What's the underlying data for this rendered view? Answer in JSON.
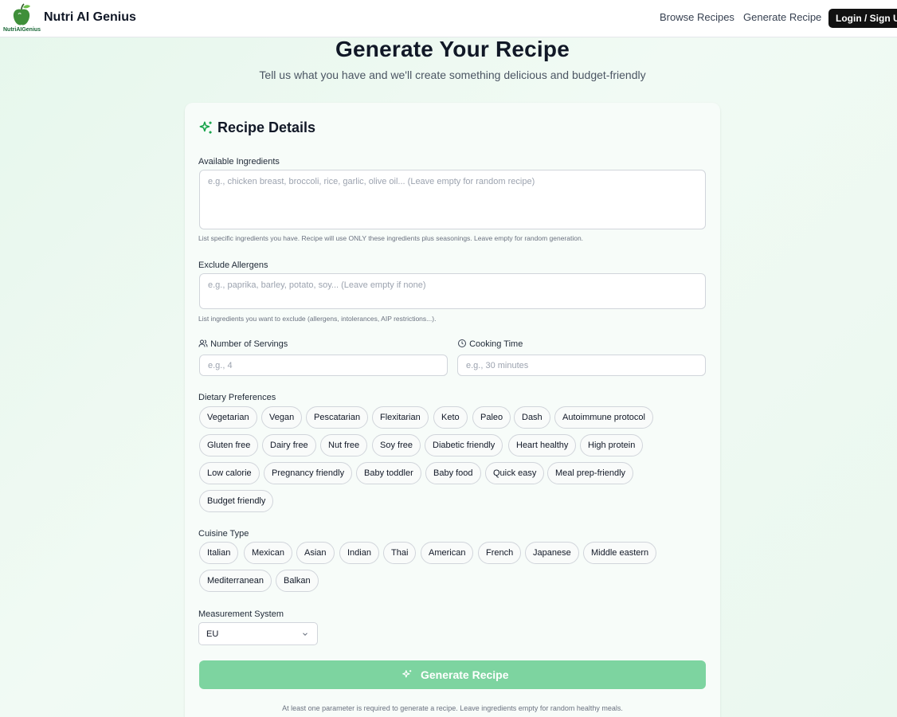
{
  "header": {
    "logo_caption": "NutriAIGenius",
    "brand": "Nutri AI Genius",
    "nav": {
      "browse": "Browse Recipes",
      "generate": "Generate Recipe"
    },
    "login": "Login / Sign Up"
  },
  "page": {
    "title": "Generate Your Recipe",
    "subtitle": "Tell us what you have and we'll create something delicious and budget-friendly"
  },
  "card": {
    "title": "Recipe Details",
    "ingredients": {
      "label": "Available Ingredients",
      "placeholder": "e.g., chicken breast, broccoli, rice, garlic, olive oil... (Leave empty for random recipe)",
      "hint": "List specific ingredients you have. Recipe will use ONLY these ingredients plus seasonings. Leave empty for random generation."
    },
    "allergens": {
      "label": "Exclude Allergens",
      "placeholder": "e.g., paprika, barley, potato, soy... (Leave empty if none)",
      "hint": "List ingredients you want to exclude (allergens, intolerances, AIP restrictions...)."
    },
    "servings": {
      "label": "Number of Servings",
      "placeholder": "e.g., 4"
    },
    "cooking_time": {
      "label": "Cooking Time",
      "placeholder": "e.g., 30 minutes"
    },
    "dietary": {
      "label": "Dietary Preferences",
      "options": [
        "Vegetarian",
        "Vegan",
        "Pescatarian",
        "Flexitarian",
        "Keto",
        "Paleo",
        "Dash",
        "Autoimmune protocol",
        "Gluten free",
        "Dairy free",
        "Nut free",
        "Soy free",
        "Diabetic friendly",
        "Heart healthy",
        "High protein",
        "Low calorie",
        "Pregnancy friendly",
        "Baby toddler",
        "Baby food",
        "Quick easy",
        "Meal prep-friendly",
        "Budget friendly"
      ]
    },
    "cuisine": {
      "label": "Cuisine Type",
      "options": [
        "Italian",
        "Mexican",
        "Asian",
        "Indian",
        "Thai",
        "American",
        "French",
        "Japanese",
        "Middle eastern",
        "Mediterranean",
        "Balkan"
      ]
    },
    "measurement": {
      "label": "Measurement System",
      "value": "EU"
    },
    "generate_button": "Generate Recipe",
    "footer_hint": "At least one parameter is required to generate a recipe. Leave ingredients empty for random healthy meals."
  },
  "colors": {
    "accent_green": "#16a34a",
    "button_green": "#7dd4a0",
    "login_bg": "#111111"
  },
  "icons": [
    "apple-logo-icon",
    "sparkles-icon",
    "users-icon",
    "clock-icon",
    "chevron-down-icon"
  ]
}
